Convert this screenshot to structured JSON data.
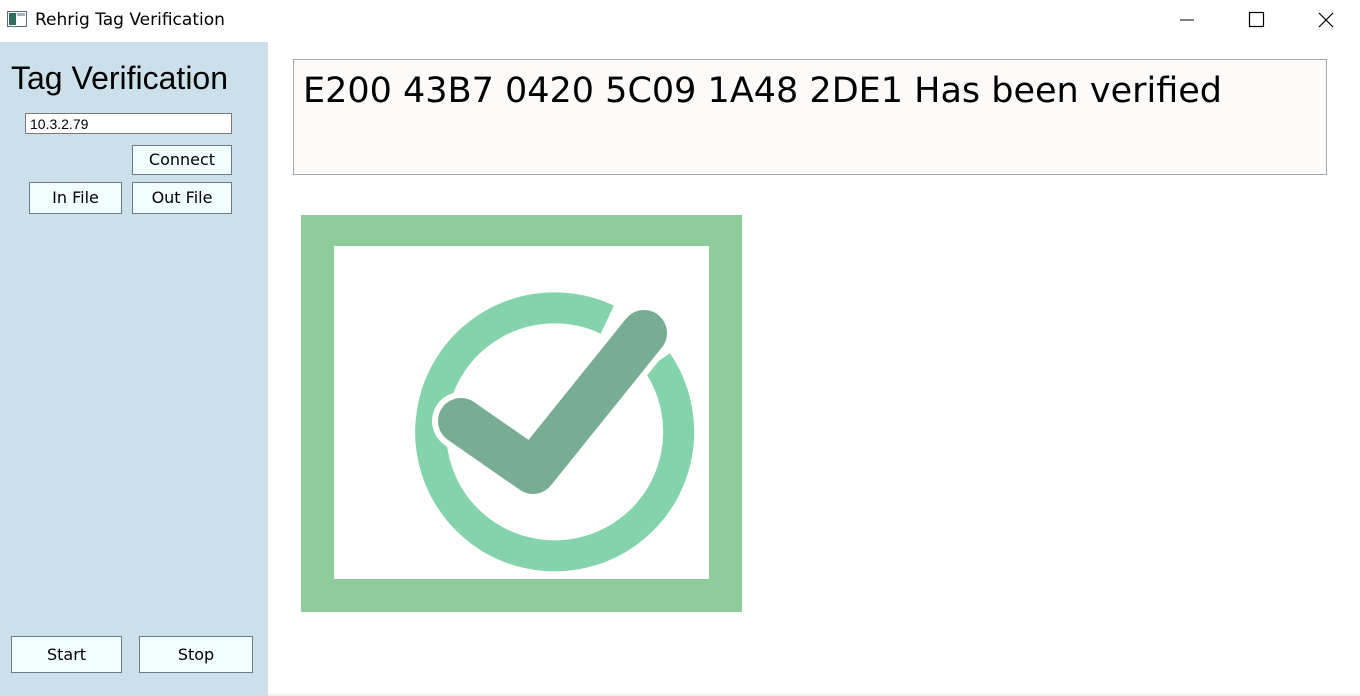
{
  "window": {
    "title": "Rehrig Tag Verification",
    "icon": "app-window-icon",
    "controls": {
      "minimize_icon": "minimize-icon",
      "maximize_icon": "maximize-icon",
      "close_icon": "close-icon"
    }
  },
  "sidebar": {
    "title": "Tag Verification",
    "ip_address": "10.3.2.79",
    "buttons": {
      "connect": "Connect",
      "in_file": "In File",
      "out_file": "Out File",
      "start": "Start",
      "stop": "Stop"
    },
    "background_color": "#cce0ec"
  },
  "main": {
    "status_message": "E200 43B7 0420 5C09 1A48 2DE1 Has been verified",
    "result_icon": "verified-checkmark-icon",
    "colors": {
      "frame": "#8ecd9b",
      "ring": "#84d3aa",
      "check": "#78ac93"
    }
  }
}
